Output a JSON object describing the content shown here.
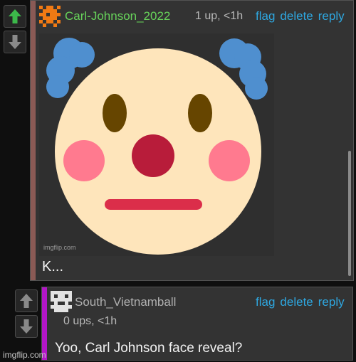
{
  "colors": {
    "accent_link": "#2ea7e0",
    "upvote_active": "#3cb84a",
    "vote_inactive": "#8a8a8a",
    "username_1": "#67d35a",
    "username_2": "#b0b0b0",
    "stripe_1": "#8a5a55",
    "stripe_2": "#b316c6"
  },
  "comment1": {
    "avatar_icon": "pixel-avatar-orange-icon",
    "username": "Carl-Johnson_2022",
    "meta": "1 up, <1h",
    "actions": {
      "flag": "flag",
      "delete": "delete",
      "reply": "reply"
    },
    "image": {
      "icon": "clown-face-emoji-icon",
      "watermark": "imgflip.com"
    },
    "text": "K..."
  },
  "comment2": {
    "avatar_icon": "pixel-avatar-gray-icon",
    "username": "South_Vietnamball",
    "meta": "0 ups, <1h",
    "actions": {
      "flag": "flag",
      "delete": "delete",
      "reply": "reply"
    },
    "text": "Yoo, Carl Johnson face reveal?"
  },
  "footer": {
    "watermark": "imgflip.com"
  }
}
